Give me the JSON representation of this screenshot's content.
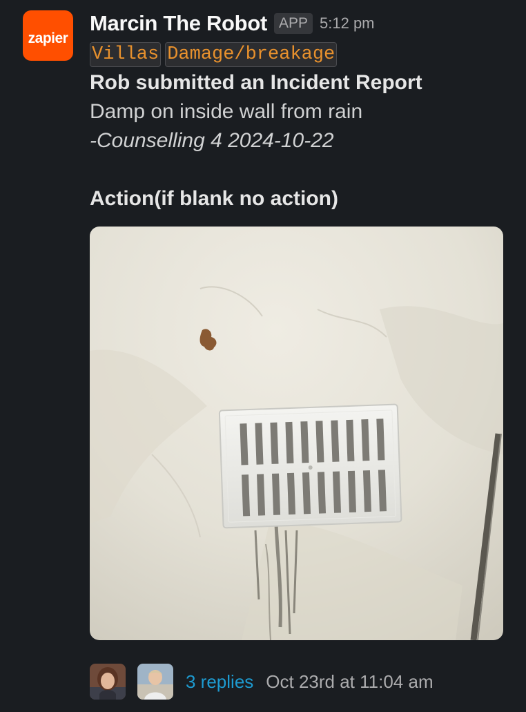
{
  "app": {
    "logo_text": "zapier",
    "accent_color": "#ff4f00"
  },
  "message": {
    "sender": "Marcin The Robot",
    "badge": "APP",
    "time": "5:12 pm",
    "tags": [
      "Villas",
      "Damage/breakage"
    ],
    "lines": {
      "title": "Rob submitted an Incident Report",
      "description": "Damp on inside wall from rain",
      "location_date": "-Counselling 4 2024-10-22",
      "action_label": "Action(if blank no action)"
    },
    "attachment": {
      "type": "image",
      "subject": "wall-vent-damp-photo"
    }
  },
  "thread": {
    "replies_text": "3 replies",
    "last_reply_text": "Oct 23rd at 11:04 am",
    "link_color": "#1d9bd1"
  }
}
